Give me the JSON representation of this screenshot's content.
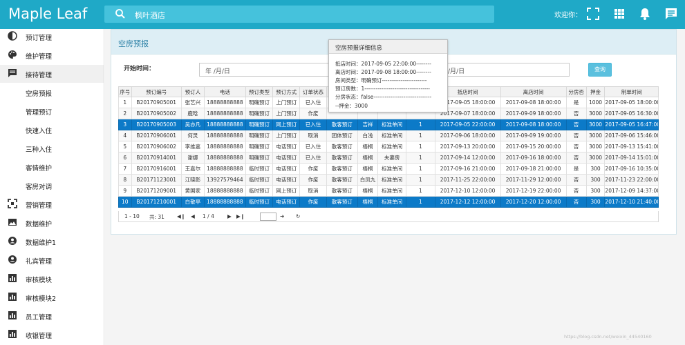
{
  "app": {
    "title": "Maple Leaf"
  },
  "search": {
    "text": "枫叶酒店"
  },
  "header": {
    "welcome": "欢迎你：",
    "icons": [
      "fullscreen-icon",
      "grid-apps-icon",
      "bell-icon",
      "chat-icon"
    ]
  },
  "sidebar": {
    "items": [
      {
        "label": "预订管理",
        "icon": "contrast-icon",
        "sub": false,
        "active": false
      },
      {
        "label": "维护管理",
        "icon": "palette-icon",
        "sub": false,
        "active": false
      },
      {
        "label": "接待管理",
        "icon": "message-icon",
        "sub": false,
        "active": true
      },
      {
        "label": "空房预报",
        "icon": "",
        "sub": true,
        "active": false
      },
      {
        "label": "管理预订",
        "icon": "",
        "sub": true,
        "active": false
      },
      {
        "label": "快速入住",
        "icon": "",
        "sub": true,
        "active": false
      },
      {
        "label": "三种入住",
        "icon": "",
        "sub": true,
        "active": false
      },
      {
        "label": "客情维护",
        "icon": "",
        "sub": true,
        "active": false
      },
      {
        "label": "客房对调",
        "icon": "",
        "sub": true,
        "active": false
      },
      {
        "label": "营销管理",
        "icon": "scan-icon",
        "sub": false,
        "active": false
      },
      {
        "label": "数据维护",
        "icon": "image-icon",
        "sub": false,
        "active": false
      },
      {
        "label": "数据维护1",
        "icon": "person-icon",
        "sub": false,
        "active": false
      },
      {
        "label": "礼宾管理",
        "icon": "person-icon",
        "sub": false,
        "active": false
      },
      {
        "label": "审核模块",
        "icon": "bar-chart-icon",
        "sub": false,
        "active": false
      },
      {
        "label": "审核模块2",
        "icon": "bar-chart-icon",
        "sub": false,
        "active": false
      },
      {
        "label": "员工管理",
        "icon": "bar-chart-icon",
        "sub": false,
        "active": false
      },
      {
        "label": "收银管理",
        "icon": "bar-chart-icon",
        "sub": false,
        "active": false
      }
    ]
  },
  "panel": {
    "title": "空房预报",
    "start_label": "开始时间：",
    "date_placeholder_1": "年 /月/日",
    "date_placeholder_2": "/月/日",
    "query_button": "查询"
  },
  "table": {
    "columns": [
      "序号",
      "预订编号",
      "预订人",
      "电话",
      "预订类型",
      "预订方式",
      "订单状态",
      "",
      "",
      "",
      "",
      "抵店时间",
      "离店时间",
      "分房否",
      "押金",
      "制单时间"
    ],
    "rows": [
      {
        "selected": false,
        "cells": [
          "1",
          "B20170905001",
          "张艺兴",
          "18888888888",
          "明确预订",
          "上门预订",
          "已入住",
          "",
          "",
          "",
          "",
          "2017-09-05 18:00:00",
          "2017-09-08 18:00:00",
          "是",
          "1000",
          "2017-09-05 18:00:00"
        ]
      },
      {
        "selected": false,
        "cells": [
          "2",
          "B20170905002",
          "鹿晗",
          "18888888888",
          "明确预订",
          "上门预订",
          "作废",
          "",
          "",
          "",
          "",
          "2017-09-07 18:00:00",
          "2017-09-09 18:00:00",
          "否",
          "3000",
          "2017-09-05 16:30:00"
        ]
      },
      {
        "selected": true,
        "cells": [
          "3",
          "B20170905003",
          "吴亦凡",
          "18888888888",
          "明确预订",
          "网上预订",
          "已入住",
          "散客预订",
          "吉祥",
          "标准单间",
          "1",
          "2017-09-05 22:00:00",
          "2017-09-08 18:00:00",
          "否",
          "3000",
          "2017-09-05 16:47:00"
        ]
      },
      {
        "selected": false,
        "cells": [
          "4",
          "B20170906001",
          "何炅",
          "18888888888",
          "明确预订",
          "上门预订",
          "取消",
          "团体预订",
          "白浅",
          "标准单间",
          "1",
          "2017-09-06 18:00:00",
          "2017-09-09 19:00:00",
          "否",
          "3000",
          "2017-09-06 15:46:00"
        ]
      },
      {
        "selected": false,
        "cells": [
          "5",
          "B20170906002",
          "李维嘉",
          "18888888888",
          "明确预订",
          "电话预订",
          "已入住",
          "散客预订",
          "梧桐",
          "标准单间",
          "1",
          "2017-09-13 20:00:00",
          "2017-09-15 20:00:00",
          "否",
          "3000",
          "2017-09-13 15:41:00"
        ]
      },
      {
        "selected": false,
        "cells": [
          "6",
          "B20170914001",
          "谢娜",
          "18888888888",
          "明确预订",
          "电话预订",
          "已入住",
          "散客预订",
          "梧桐",
          "夫妻房",
          "1",
          "2017-09-14 12:00:00",
          "2017-09-16 18:00:00",
          "否",
          "3000",
          "2017-09-14 15:01:00"
        ]
      },
      {
        "selected": false,
        "cells": [
          "7",
          "B20170916001",
          "王嘉尔",
          "18888888888",
          "临时预订",
          "电话预订",
          "作废",
          "散客预订",
          "梧桐",
          "标准单间",
          "1",
          "2017-09-16 21:00:00",
          "2017-09-18 21:00:00",
          "是",
          "300",
          "2017-09-16 10:35:00"
        ]
      },
      {
        "selected": false,
        "cells": [
          "8",
          "B20171123001",
          "江晓影",
          "13927579464",
          "临时预订",
          "电话预订",
          "作废",
          "散客预订",
          "白凤九",
          "标准单间",
          "1",
          "2017-11-25 22:00:00",
          "2017-11-29 12:00:00",
          "否",
          "300",
          "2017-11-23 22:00:00"
        ]
      },
      {
        "selected": false,
        "cells": [
          "9",
          "B20171209001",
          "黄国家",
          "18888888888",
          "临时预订",
          "网上预订",
          "取消",
          "散客预订",
          "梧桐",
          "标准单间",
          "1",
          "2017-12-10 12:00:00",
          "2017-12-19 22:00:00",
          "否",
          "300",
          "2017-12-09 14:37:00"
        ]
      },
      {
        "selected": true,
        "cells": [
          "10",
          "B20171210001",
          "白敬亭",
          "18888888888",
          "临时预订",
          "电话预订",
          "作废",
          "散客预订",
          "梧桐",
          "标准单间",
          "1",
          "2017-12-12 12:00:00",
          "2017-12-20 12:00:00",
          "否",
          "300",
          "2017-12-10 21:40:00"
        ]
      }
    ]
  },
  "pager": {
    "range": "1 - 10",
    "total": "共: 31",
    "page": "1 / 4"
  },
  "tooltip": {
    "title": "空房预报详细信息",
    "lines": [
      "抵店时间：2017-09-05 22:00:00--------",
      "离店时间：2017-09-08 18:00:00--------",
      "房间类型：明确预订------------------------",
      "预订房数：1-----------------------------------",
      "分房状态：false-------------------------------",
      "--押金：3000"
    ]
  },
  "watermark": "https://blog.csdn.net/weixin_44540160"
}
